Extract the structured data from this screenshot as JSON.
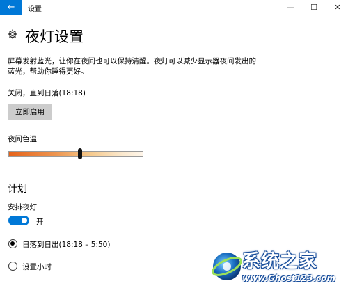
{
  "window": {
    "title": "设置",
    "back_icon": "back-arrow-icon",
    "minimize_glyph": "—",
    "maximize_glyph": "☐",
    "close_glyph": "✕",
    "accent_color": "#0078d7"
  },
  "page": {
    "icon": "gear-icon",
    "title": "夜灯设置",
    "description": "屏幕发射蓝光，让你在夜间也可以保持清醒。夜灯可以减少显示器夜间发出的蓝光，帮助你睡得更好。",
    "status": "关闭，直到日落(18:18)",
    "enable_button": "立即启用"
  },
  "color_temperature": {
    "label": "夜间色温",
    "level": 0.53
  },
  "schedule": {
    "section_title": "计划",
    "toggle_label": "安排夜灯",
    "toggle_state_text": "开",
    "toggle_on": true,
    "options": [
      {
        "label": "日落到日出(18:18 – 5:50)",
        "selected": true
      },
      {
        "label": "设置小时",
        "selected": false
      }
    ]
  },
  "watermark": {
    "brand": "系统之家",
    "url": "www.Ghost123.com"
  }
}
